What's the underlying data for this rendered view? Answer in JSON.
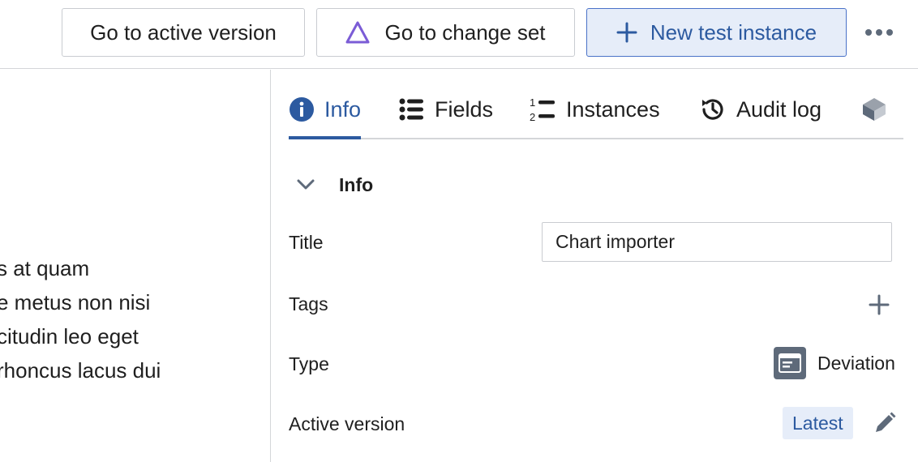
{
  "toolbar": {
    "active_version_label": "Go to active version",
    "change_set_label": "Go to change set",
    "new_test_label": "New test instance"
  },
  "left_pane": {
    "lines": [
      "s at quam",
      "e metus non nisi",
      "citudin leo eget",
      "rhoncus lacus dui"
    ]
  },
  "tabs": [
    {
      "label": "Info",
      "icon": "info-icon",
      "active": true
    },
    {
      "label": "Fields",
      "icon": "list-icon"
    },
    {
      "label": "Instances",
      "icon": "numbered-list-icon"
    },
    {
      "label": "Audit log",
      "icon": "history-icon"
    }
  ],
  "info_section": {
    "title": "Info",
    "title_label": "Title",
    "title_value": "Chart importer",
    "tags_label": "Tags",
    "type_label": "Type",
    "type_value": "Deviation",
    "active_version_label": "Active version",
    "active_version_value": "Latest"
  },
  "colors": {
    "accent": "#2c5aa0",
    "accent_bg": "#e6edf9",
    "border": "#d4d6d9",
    "triangle": "#7b5cd6"
  }
}
